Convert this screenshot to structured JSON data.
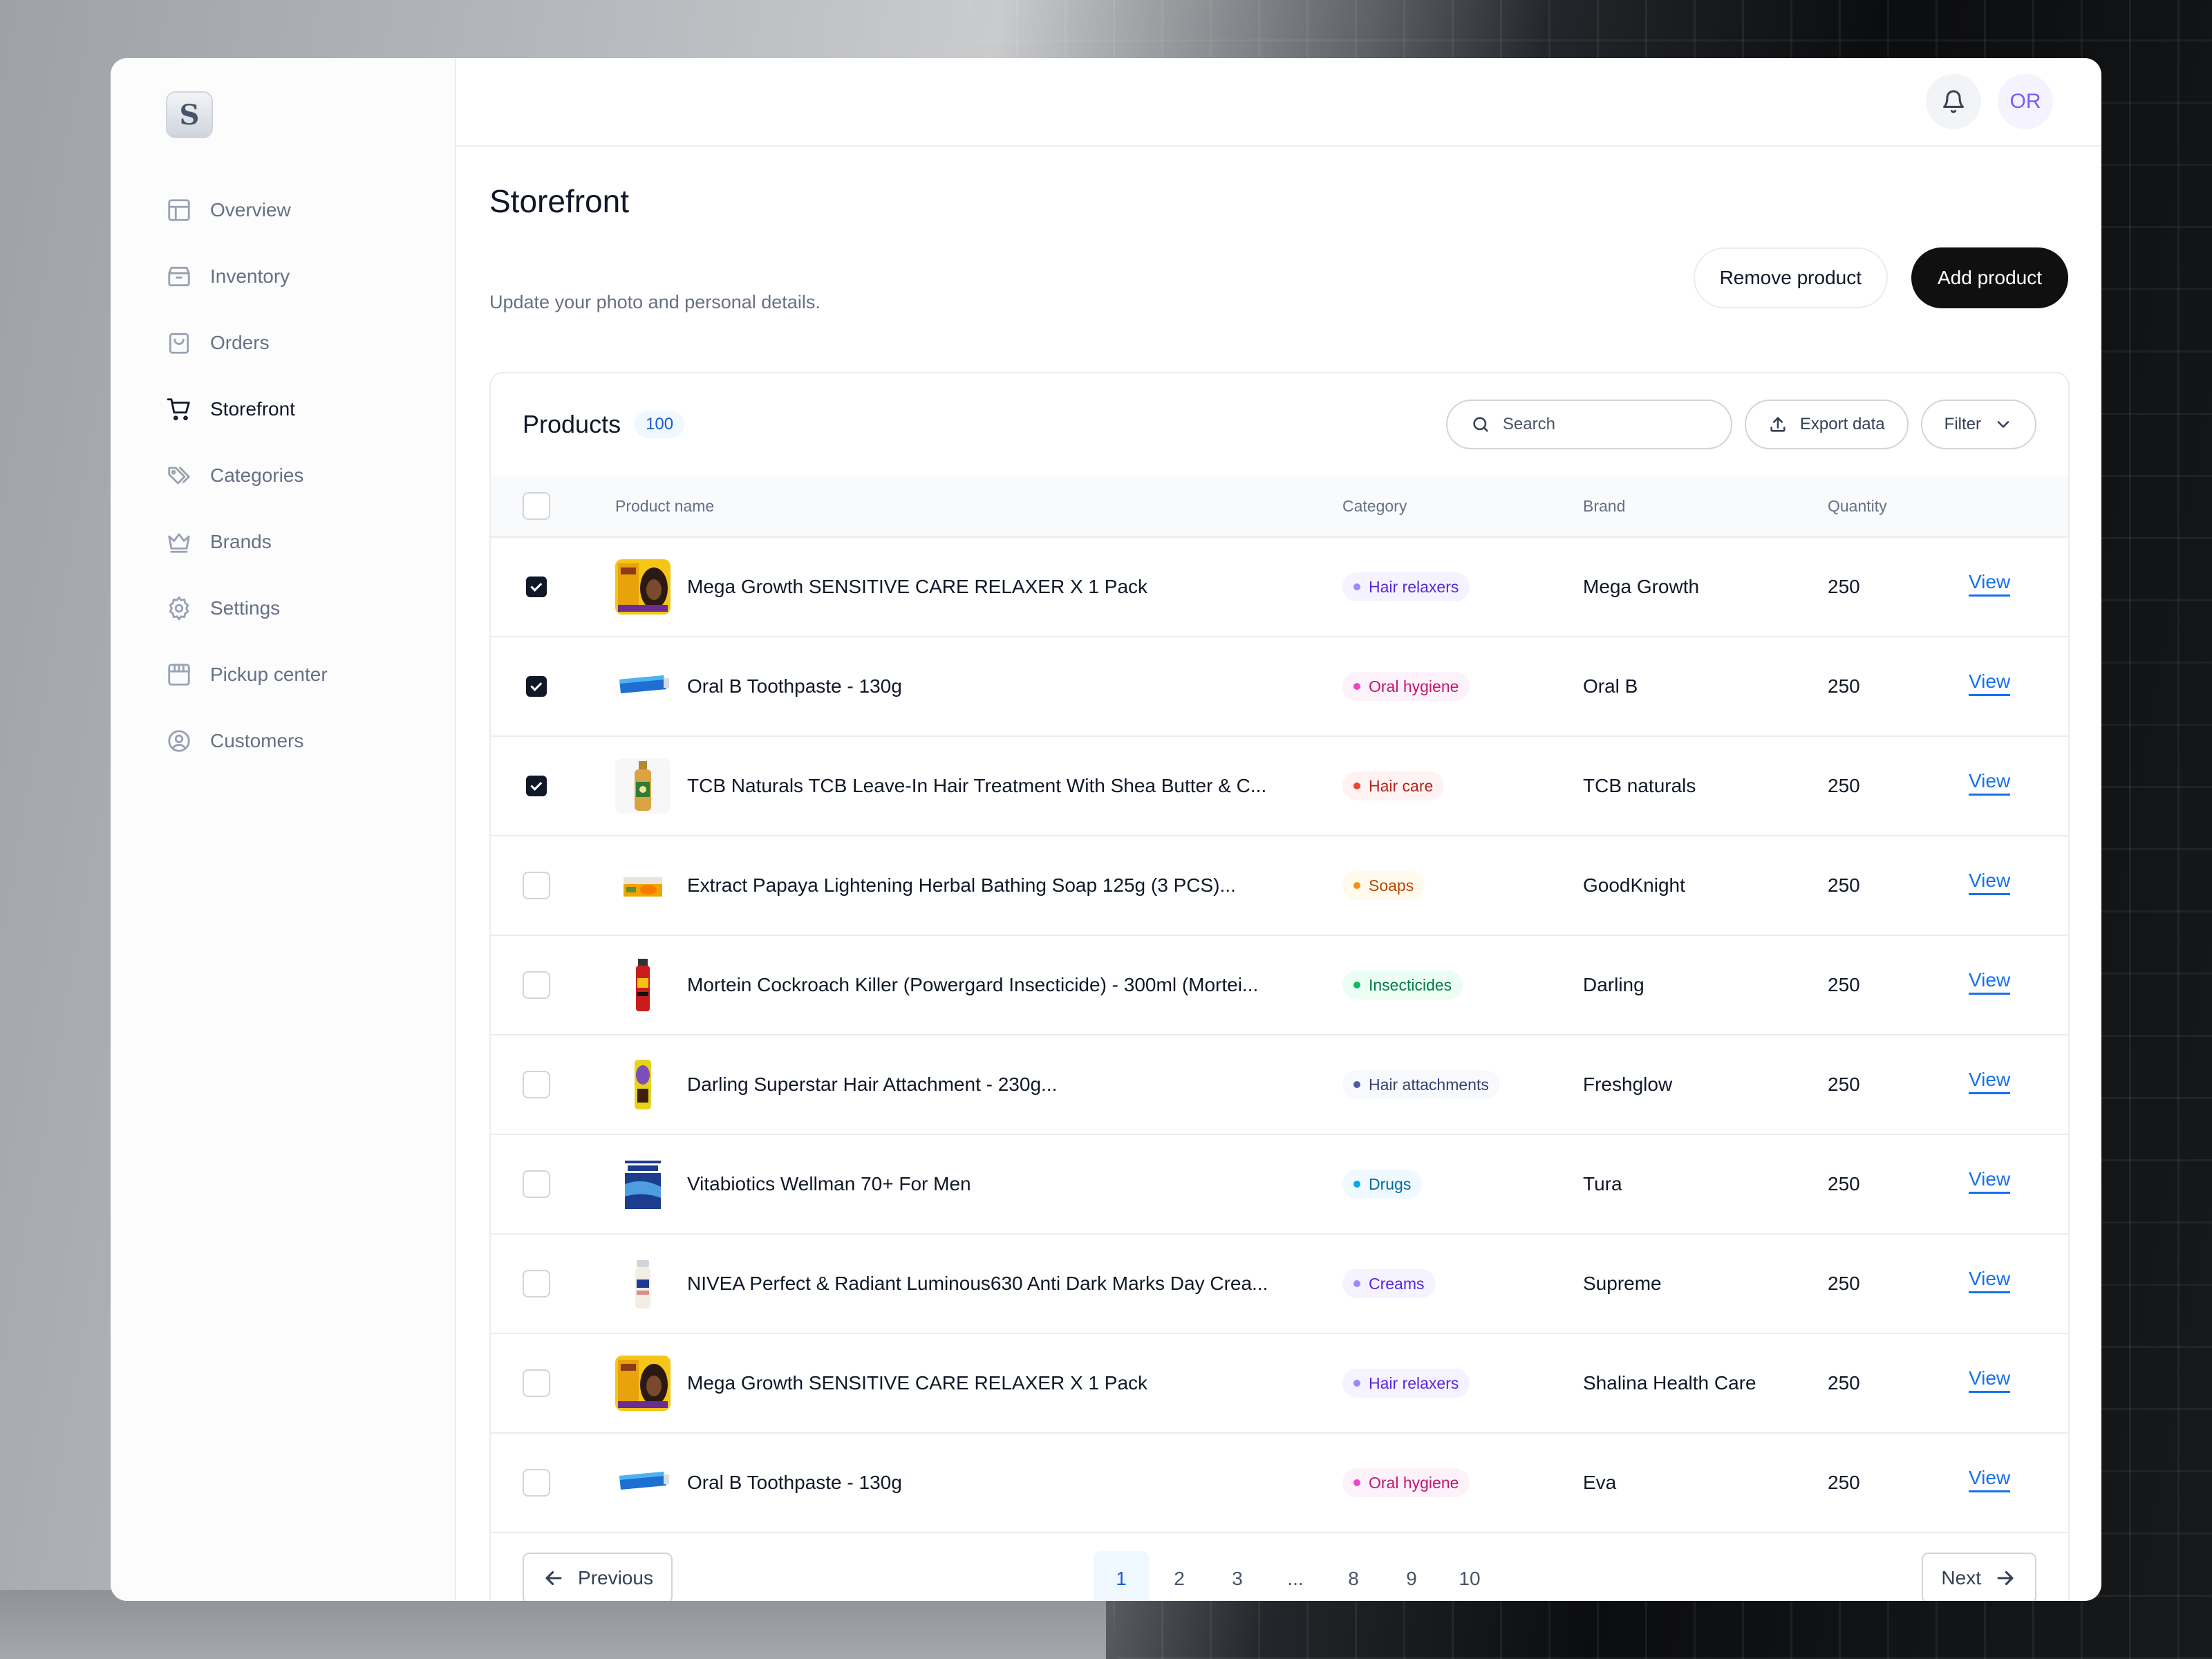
{
  "sidebar": {
    "logo_letter": "S",
    "items": [
      {
        "label": "Overview",
        "icon": "layout-icon"
      },
      {
        "label": "Inventory",
        "icon": "box-icon"
      },
      {
        "label": "Orders",
        "icon": "shopping-bag-icon"
      },
      {
        "label": "Storefront",
        "icon": "cart-icon",
        "active": true
      },
      {
        "label": "Categories",
        "icon": "tags-icon"
      },
      {
        "label": "Brands",
        "icon": "crown-icon"
      },
      {
        "label": "Settings",
        "icon": "gear-icon"
      },
      {
        "label": "Pickup center",
        "icon": "store-icon"
      },
      {
        "label": "Customers",
        "icon": "user-circle-icon"
      }
    ]
  },
  "topbar": {
    "notification_icon": "bell-icon",
    "avatar_initials": "OR"
  },
  "header": {
    "title": "Storefront",
    "subtitle": "Update your photo and personal details.",
    "remove_label": "Remove product",
    "add_label": "Add product"
  },
  "products": {
    "title": "Products",
    "count": "100",
    "search_placeholder": "Search",
    "export_label": "Export data",
    "filter_label": "Filter",
    "columns": {
      "name": "Product name",
      "category": "Category",
      "brand": "Brand",
      "quantity": "Quantity"
    },
    "rows": [
      {
        "checked": true,
        "name": "Mega Growth SENSITIVE CARE RELAXER X 1 Pack",
        "category": "Hair relaxers",
        "brand": "Mega Growth",
        "quantity": "250",
        "action": "View",
        "thumb": "relaxer"
      },
      {
        "checked": true,
        "name": "Oral B Toothpaste - 130g",
        "category": "Oral hygiene",
        "brand": "Oral B",
        "quantity": "250",
        "action": "View",
        "thumb": "toothpaste"
      },
      {
        "checked": true,
        "name": "TCB Naturals TCB Leave-In Hair Treatment With Shea Butter & C...",
        "category": "Hair care",
        "brand": "TCB naturals",
        "quantity": "250",
        "action": "View",
        "thumb": "bottle"
      },
      {
        "checked": false,
        "name": "Extract Papaya Lightening Herbal Bathing Soap 125g (3 PCS)...",
        "category": "Soaps",
        "brand": "GoodKnight",
        "quantity": "250",
        "action": "View",
        "thumb": "soap"
      },
      {
        "checked": false,
        "name": "Mortein Cockroach Killer (Powergard Insecticide) - 300ml (Mortei...",
        "category": "Insecticides",
        "brand": "Darling",
        "quantity": "250",
        "action": "View",
        "thumb": "spray"
      },
      {
        "checked": false,
        "name": "Darling Superstar Hair Attachment - 230g...",
        "category": "Hair attachments",
        "brand": "Freshglow",
        "quantity": "250",
        "action": "View",
        "thumb": "attachment"
      },
      {
        "checked": false,
        "name": "Vitabiotics Wellman 70+ For Men",
        "category": "Drugs",
        "brand": "Tura",
        "quantity": "250",
        "action": "View",
        "thumb": "drugbox"
      },
      {
        "checked": false,
        "name": "NIVEA Perfect & Radiant Luminous630 Anti Dark Marks Day Crea...",
        "category": "Creams",
        "brand": "Supreme",
        "quantity": "250",
        "action": "View",
        "thumb": "cream"
      },
      {
        "checked": false,
        "name": "Mega Growth SENSITIVE CARE RELAXER X 1 Pack",
        "category": "Hair relaxers",
        "brand": "Shalina Health Care",
        "quantity": "250",
        "action": "View",
        "thumb": "relaxer"
      },
      {
        "checked": false,
        "name": "Oral B Toothpaste - 130g",
        "category": "Oral hygiene",
        "brand": "Eva",
        "quantity": "250",
        "action": "View",
        "thumb": "toothpaste"
      }
    ],
    "category_colors": {
      "Hair relaxers": {
        "bg": "#f4f3ff",
        "fg": "#5925dc",
        "dot": "#9b8afb"
      },
      "Oral hygiene": {
        "bg": "#fdf2fa",
        "fg": "#c11574",
        "dot": "#ee46bc"
      },
      "Hair care": {
        "bg": "#fef3f2",
        "fg": "#b42318",
        "dot": "#f04438"
      },
      "Soaps": {
        "bg": "#fffaeb",
        "fg": "#b54708",
        "dot": "#f79009"
      },
      "Insecticides": {
        "bg": "#ecfdf3",
        "fg": "#027a48",
        "dot": "#12b76a"
      },
      "Hair attachments": {
        "bg": "#f8f9fc",
        "fg": "#363f72",
        "dot": "#4e5ba6"
      },
      "Drugs": {
        "bg": "#f0f9ff",
        "fg": "#026aa2",
        "dot": "#0ba5ec"
      },
      "Creams": {
        "bg": "#f4f3ff",
        "fg": "#5925dc",
        "dot": "#9b8afb"
      }
    }
  },
  "pagination": {
    "previous_label": "Previous",
    "next_label": "Next",
    "pages": [
      "1",
      "2",
      "3",
      "...",
      "8",
      "9",
      "10"
    ],
    "current": "1"
  }
}
